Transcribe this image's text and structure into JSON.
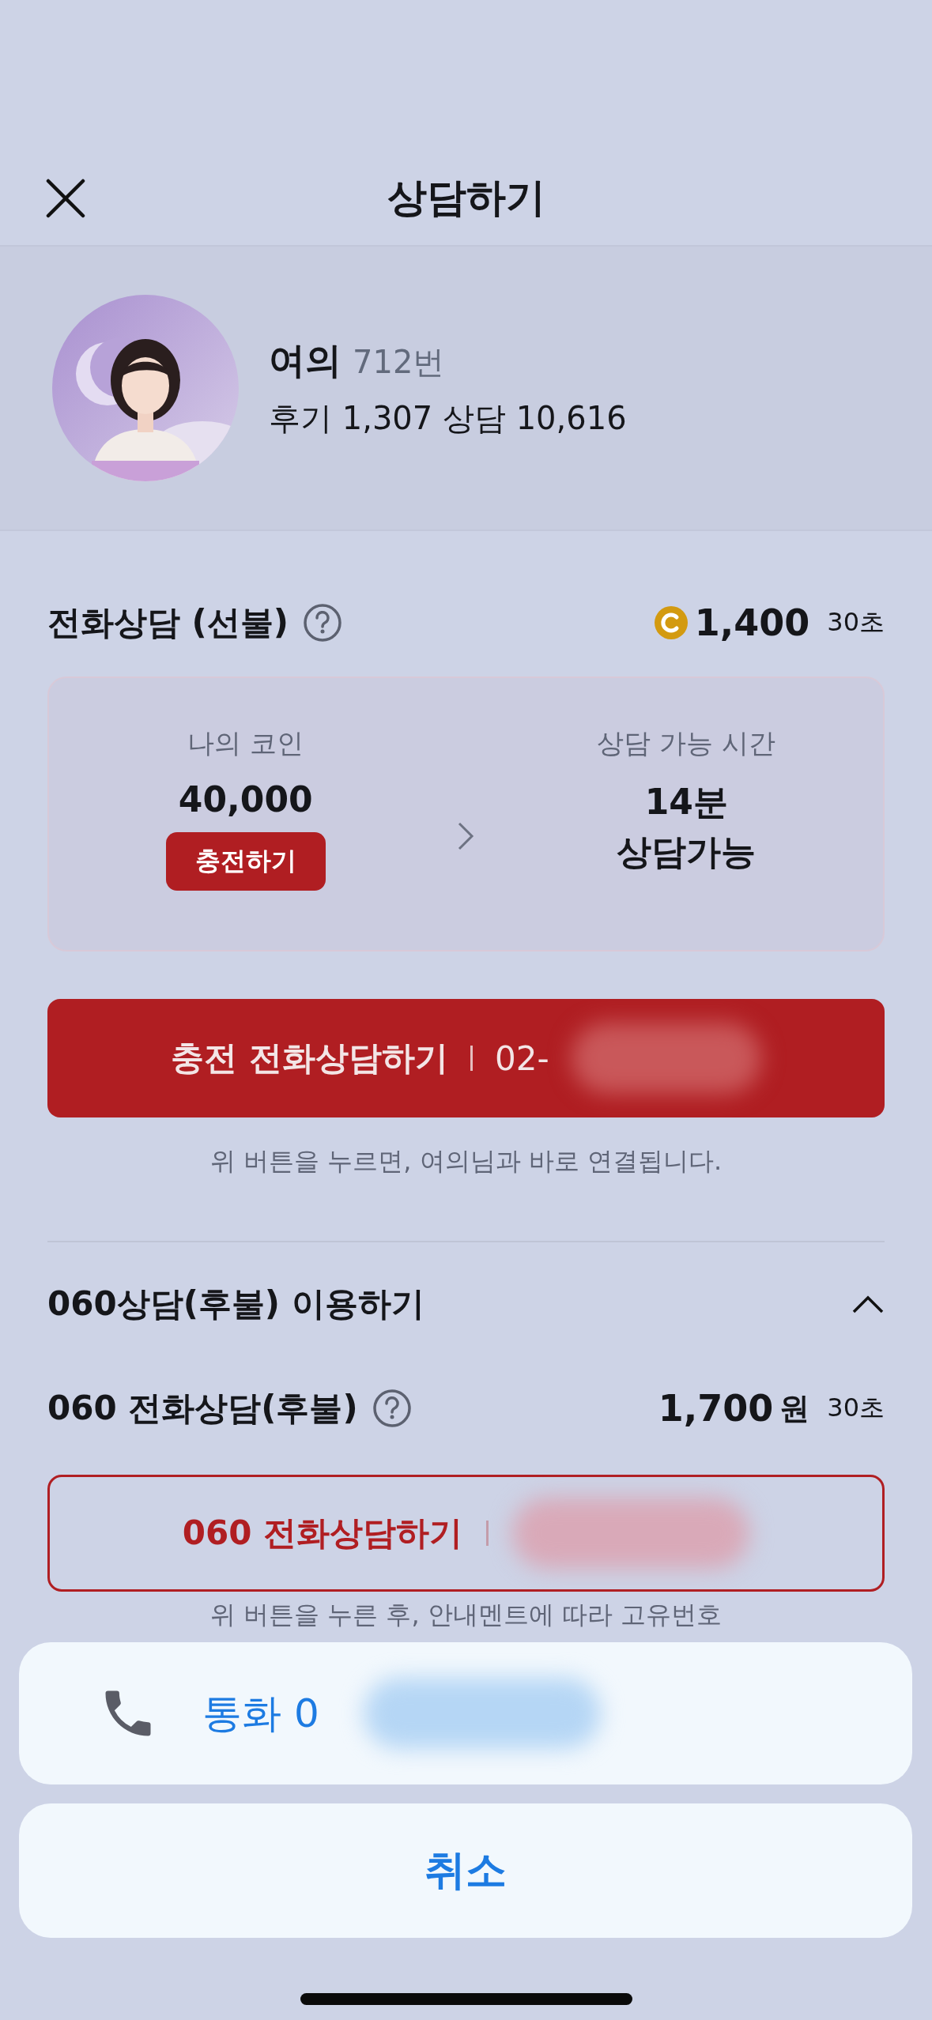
{
  "header": {
    "title": "상담하기"
  },
  "profile": {
    "name": "여의",
    "number": "712번",
    "stats": "후기 1,307 상담 10,616"
  },
  "prepaid": {
    "title": "전화상담 (선불)",
    "price": "1,400",
    "per": "30초",
    "my_coin_label": "나의 코인",
    "my_coin": "40,000",
    "charge_button": "충전하기",
    "time_label": "상담 가능 시간",
    "time_value": "14분",
    "time_note": "상담가능",
    "call_button": {
      "label": "충전 전화상담하기",
      "number": "02-"
    },
    "caption": "위 버튼을 누르면, 여의님과 바로 연결됩니다."
  },
  "postpaid": {
    "title": "060상담(후불) 이용하기",
    "expanded": true,
    "row_title": "060 전화상담(후불)",
    "price": "1,700",
    "unit": "원",
    "per": "30초",
    "call_button": {
      "label": "060 전화상담하기"
    },
    "caption": "위 버튼을 누른 후, 안내멘트에 따라 고유번호"
  },
  "action_sheet": {
    "call_label": "통화 0",
    "cancel": "취소"
  }
}
